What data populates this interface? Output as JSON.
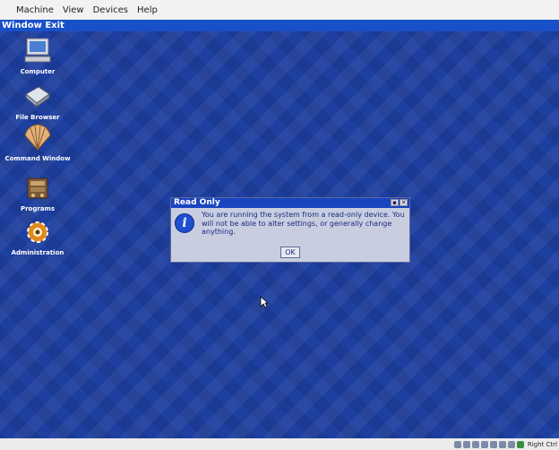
{
  "menubar": {
    "items": [
      {
        "label": "Machine"
      },
      {
        "label": "View"
      },
      {
        "label": "Devices"
      },
      {
        "label": "Help"
      }
    ]
  },
  "desktop": {
    "window_title": "Window Exit",
    "icons": [
      {
        "label": "Computer",
        "icon": "computer-icon"
      },
      {
        "label": "File Browser",
        "icon": "file-browser-icon"
      },
      {
        "label": "Command Window",
        "icon": "shell-icon"
      },
      {
        "label": "Programs",
        "icon": "programs-icon"
      },
      {
        "label": "Administration",
        "icon": "administration-icon"
      }
    ]
  },
  "dialog": {
    "title": "Read Only",
    "icon": "info-icon",
    "message": "You are running the system from a read-only device. You will not be able to alter settings, or generally change anything.",
    "ok_label": "OK"
  },
  "statusbar": {
    "host_key_label": "Right Ctrl"
  },
  "colors": {
    "desktop_bg": "#1d3fa0",
    "titlebar": "#1850c8",
    "dialog_bg": "#c8cde0"
  }
}
